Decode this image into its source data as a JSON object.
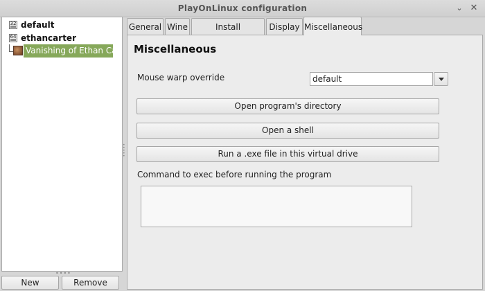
{
  "window": {
    "title": "PlayOnLinux configuration"
  },
  "tree": {
    "items": [
      {
        "label": "default",
        "badge": "32"
      },
      {
        "label": "ethancarter",
        "badge": "64"
      }
    ],
    "selected": {
      "label": "Vanishing of Ethan Carter"
    }
  },
  "footer": {
    "new_label": "New",
    "remove_label": "Remove"
  },
  "tabs": [
    {
      "label": "General"
    },
    {
      "label": "Wine"
    },
    {
      "label": "Install components"
    },
    {
      "label": "Display"
    },
    {
      "label": "Miscellaneous"
    }
  ],
  "misc": {
    "heading": "Miscellaneous",
    "mouse_warp_label": "Mouse warp override",
    "mouse_warp_value": "default",
    "open_dir_label": "Open program's directory",
    "shell_label": "Open a shell",
    "run_exe_label": "Run a .exe file in this virtual drive",
    "command_label": "Command to exec before running the program",
    "command_value": ""
  },
  "icons": {
    "minimize": "minimize-icon",
    "close": "close-icon",
    "dropdown": "chevron-down-icon"
  },
  "colors": {
    "selection": "#86a85a"
  }
}
